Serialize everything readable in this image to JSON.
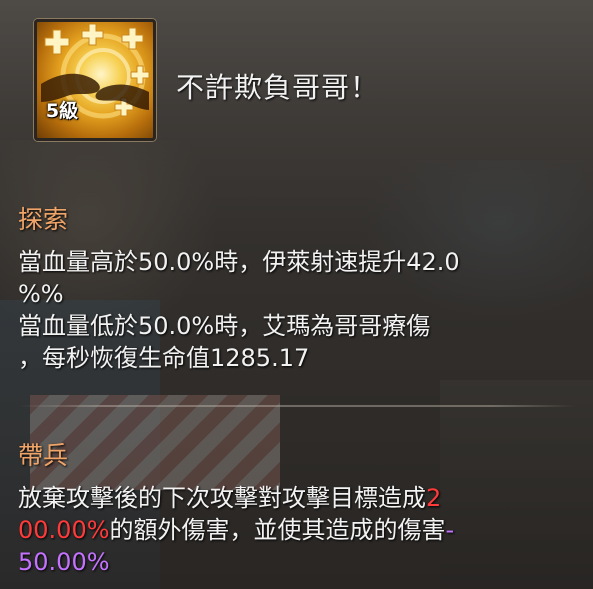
{
  "skill": {
    "name": "不許欺負哥哥！",
    "level": "5級",
    "icon": "healing-handshake-icon"
  },
  "sections": [
    {
      "title": "探索",
      "lines": [
        "當血量高於50.0%時，伊萊射速提升42.0",
        "%%",
        "當血量低於50.0%時，艾瑪為哥哥療傷",
        "，每秒恢復生命值1285.17"
      ]
    },
    {
      "title": "帶兵",
      "line1_prefix": "放棄攻擊後的下次攻擊對攻擊目標造成",
      "line1_red": "2",
      "line2_red": "00.00%",
      "line2_middle": "的額外傷害，並使其造成的傷害",
      "line2_purple": "-",
      "line3_purple": "50.00%"
    }
  ],
  "colors": {
    "section_title": "#f0a467",
    "highlight_red": "#ff3a3a",
    "highlight_purple": "#c472ff",
    "text": "#f2f2f2"
  }
}
